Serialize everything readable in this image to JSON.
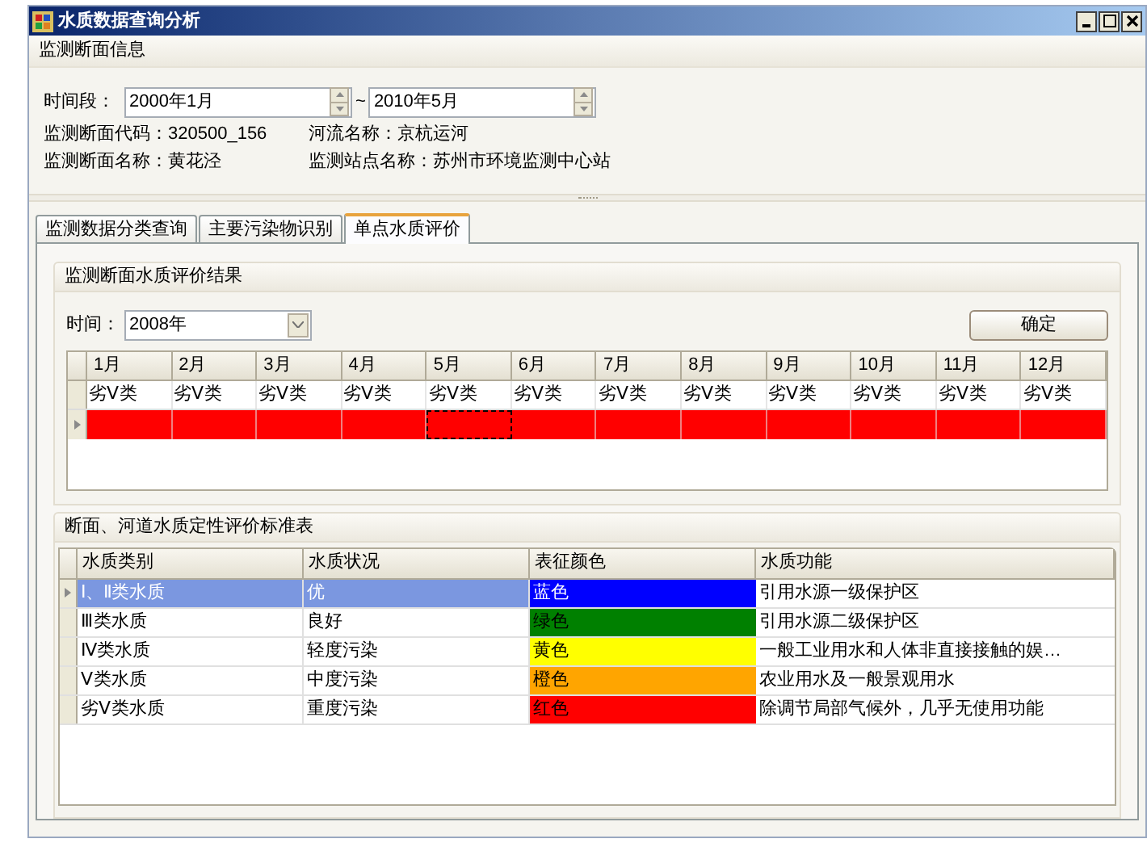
{
  "window": {
    "title": "水质数据查询分析"
  },
  "section": {
    "title": "监测断面信息"
  },
  "period": {
    "label": "时间段：",
    "from": "2000年1月",
    "separator": "~",
    "to": "2010年5月"
  },
  "info": [
    {
      "label": "监测断面代码：",
      "value": "320500_156"
    },
    {
      "label": "河流名称：",
      "value": "京杭运河"
    },
    {
      "label": "监测断面名称：",
      "value": "黄花泾"
    },
    {
      "label": "监测站点名称：",
      "value": "苏州市环境监测中心站"
    }
  ],
  "tabs": [
    {
      "label": "监测数据分类查询",
      "selected": false
    },
    {
      "label": "主要污染物识别",
      "selected": false
    },
    {
      "label": "单点水质评价",
      "selected": true
    }
  ],
  "evaluation": {
    "title": "监测断面水质评价结果",
    "time_label": "时间：",
    "time_value": "2008年",
    "confirm_button": "确定",
    "months": [
      {
        "label": "1月",
        "value": "劣Ⅴ类",
        "color": "#ff0000",
        "focused": false
      },
      {
        "label": "2月",
        "value": "劣Ⅴ类",
        "color": "#ff0000",
        "focused": false
      },
      {
        "label": "3月",
        "value": "劣Ⅴ类",
        "color": "#ff0000",
        "focused": false
      },
      {
        "label": "4月",
        "value": "劣Ⅴ类",
        "color": "#ff0000",
        "focused": false
      },
      {
        "label": "5月",
        "value": "劣Ⅴ类",
        "color": "#ff0000",
        "focused": true
      },
      {
        "label": "6月",
        "value": "劣Ⅴ类",
        "color": "#ff0000",
        "focused": false
      },
      {
        "label": "7月",
        "value": "劣Ⅴ类",
        "color": "#ff0000",
        "focused": false
      },
      {
        "label": "8月",
        "value": "劣Ⅴ类",
        "color": "#ff0000",
        "focused": false
      },
      {
        "label": "9月",
        "value": "劣Ⅴ类",
        "color": "#ff0000",
        "focused": false
      },
      {
        "label": "10月",
        "value": "劣Ⅴ类",
        "color": "#ff0000",
        "focused": false
      },
      {
        "label": "11月",
        "value": "劣Ⅴ类",
        "color": "#ff0000",
        "focused": false
      },
      {
        "label": "12月",
        "value": "劣Ⅴ类",
        "color": "#ff0000",
        "focused": false
      }
    ]
  },
  "standards": {
    "title": "断面、河道水质定性评价标准表",
    "columns": [
      "水质类别",
      "水质状况",
      "表征颜色",
      "水质功能"
    ],
    "rows": [
      {
        "category": "Ⅰ、Ⅱ类水质",
        "condition": "优",
        "color_name": "蓝色",
        "color": "#0000ff",
        "function": "引用水源一级保护区",
        "selected": true
      },
      {
        "category": "Ⅲ类水质",
        "condition": "良好",
        "color_name": "绿色",
        "color": "#008000",
        "function": "引用水源二级保护区",
        "selected": false
      },
      {
        "category": "Ⅳ类水质",
        "condition": "轻度污染",
        "color_name": "黄色",
        "color": "#ffff00",
        "function": "一般工业用水和人体非直接接触的娱…",
        "selected": false
      },
      {
        "category": "Ⅴ类水质",
        "condition": "中度污染",
        "color_name": "橙色",
        "color": "#ffa500",
        "function": "农业用水及一般景观用水",
        "selected": false
      },
      {
        "category": "劣Ⅴ类水质",
        "condition": "重度污染",
        "color_name": "红色",
        "color": "#ff0000",
        "function": "除调节局部气候外，几乎无使用功能",
        "selected": false
      }
    ]
  }
}
